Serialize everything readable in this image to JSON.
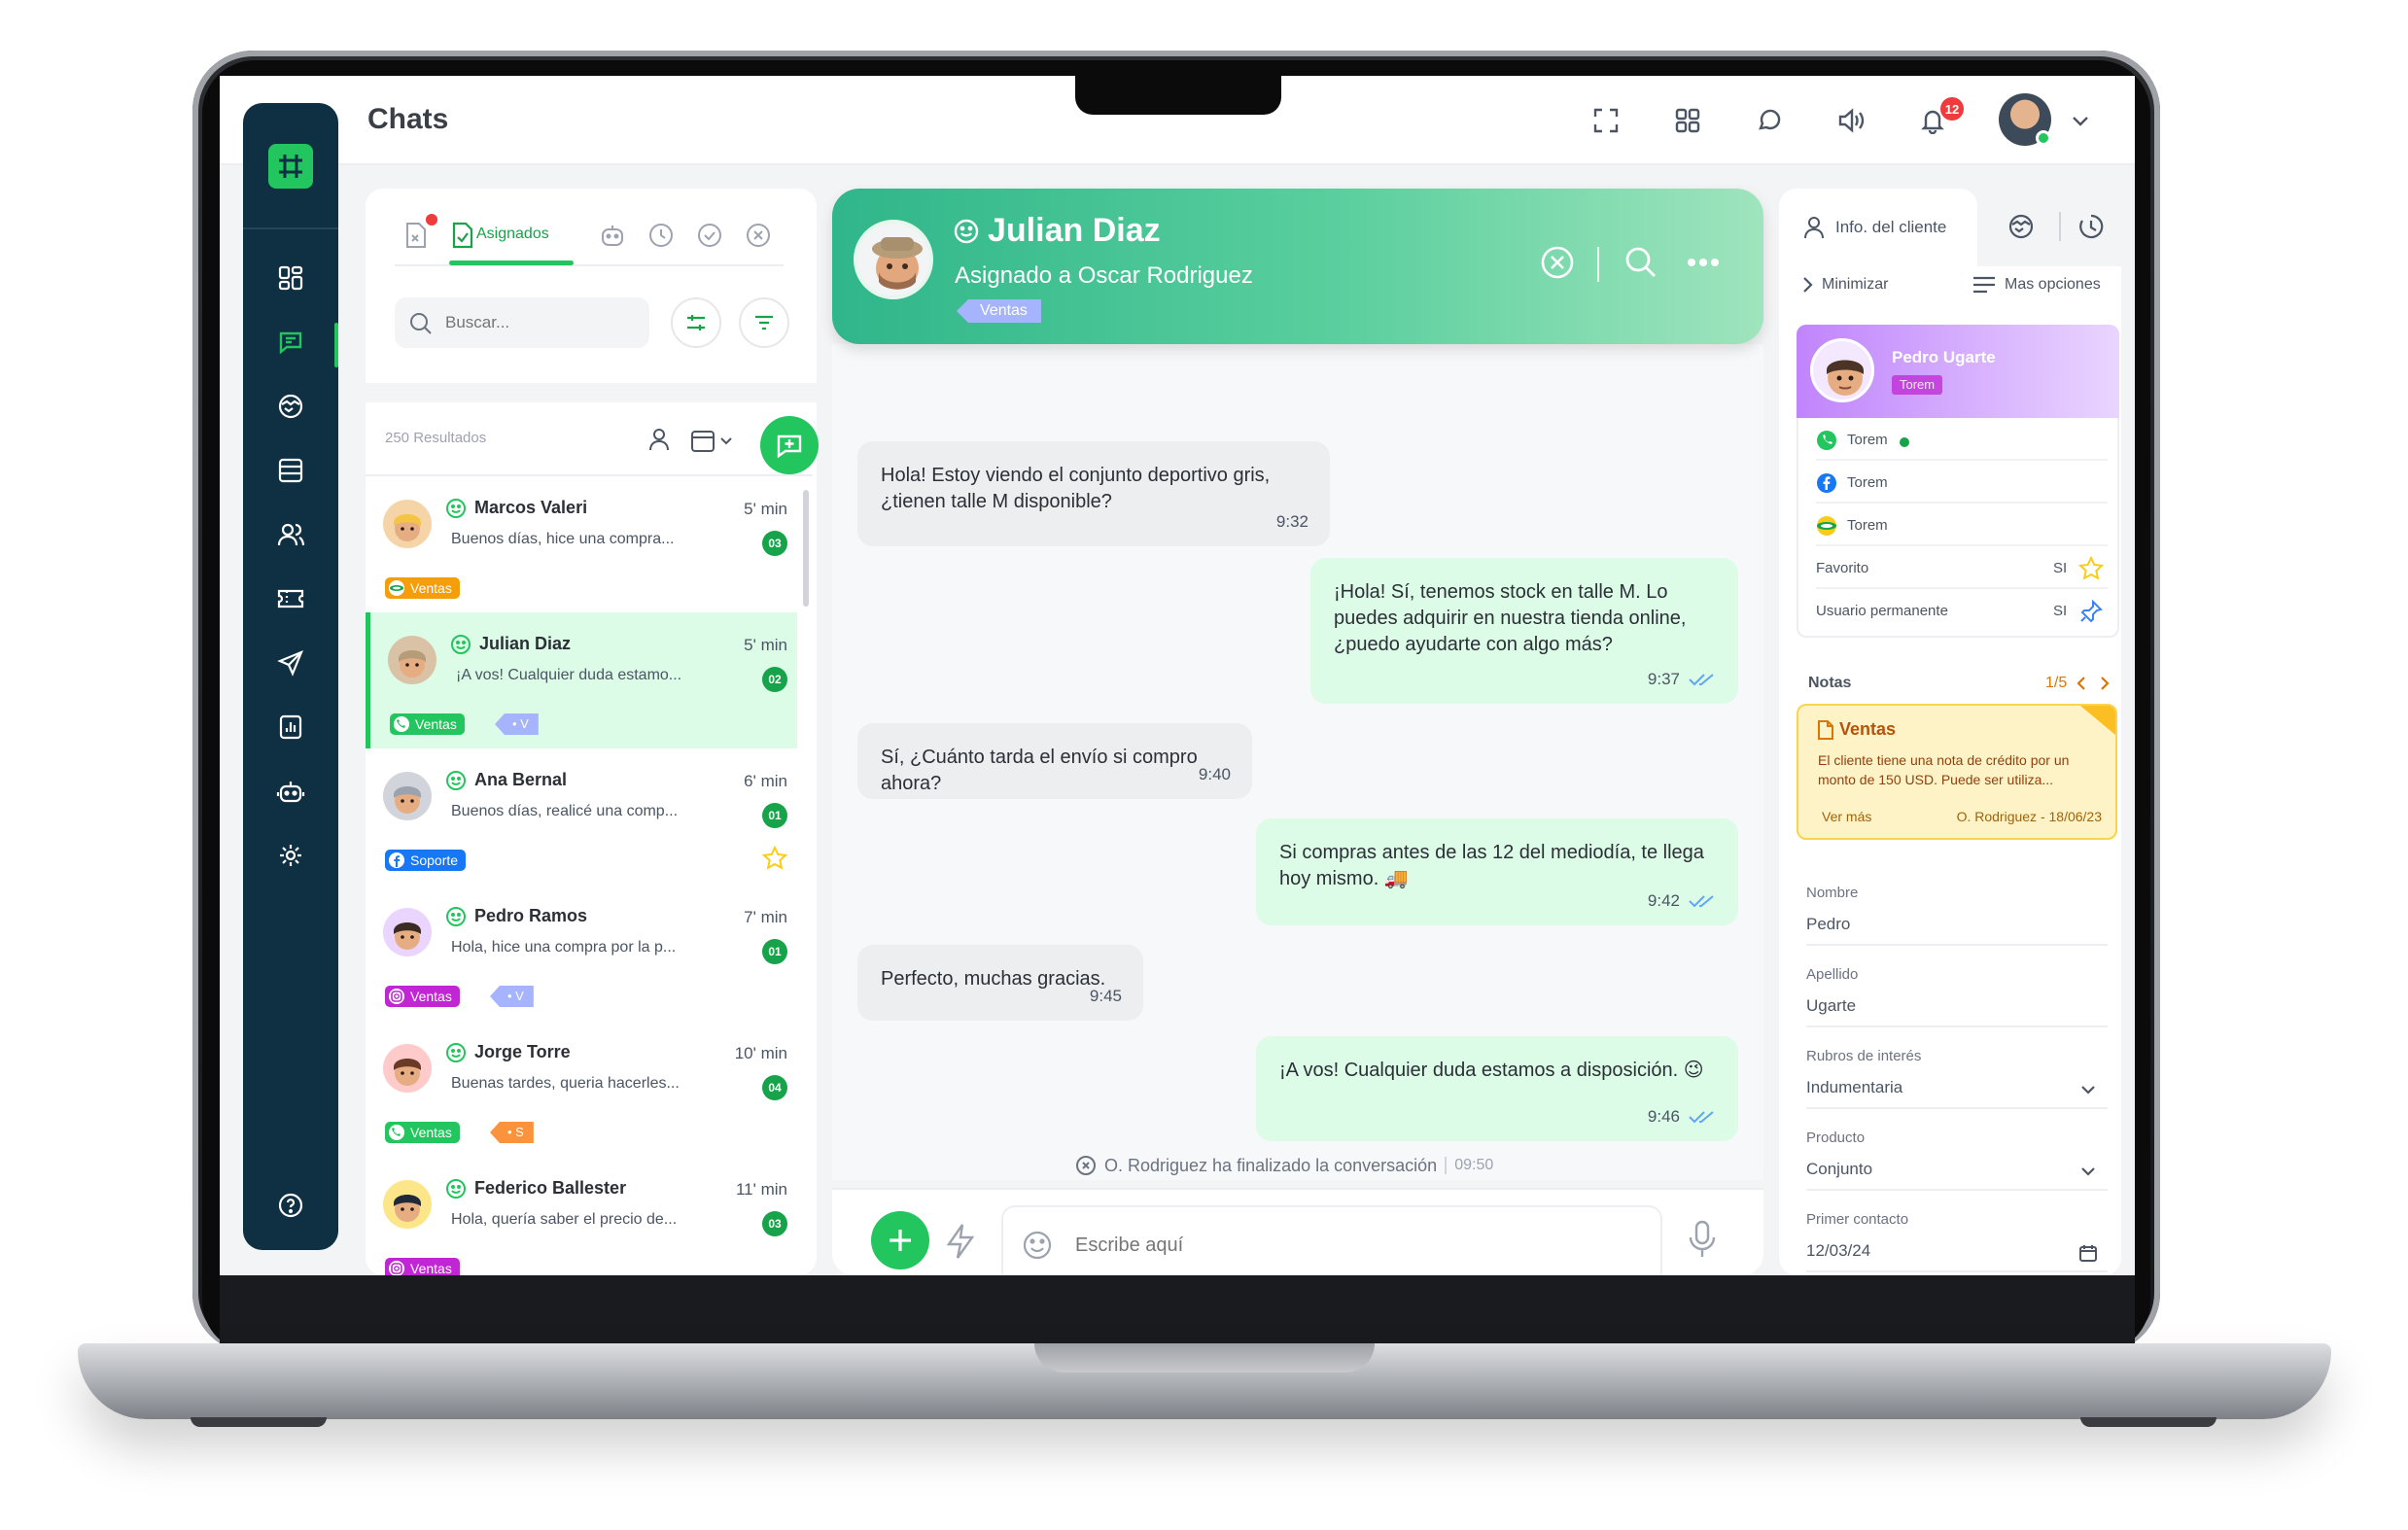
{
  "app": {
    "title": "Chats",
    "notifications_count": "12"
  },
  "list": {
    "active_tab_label": "Asignados",
    "search_placeholder": "Buscar...",
    "results": "250 Resultados",
    "chats": [
      {
        "name": "Marcos Valeri",
        "time": "5' min",
        "preview": "Buenos días, hice una compra...",
        "count": "03",
        "tag": "Ventas",
        "tag_color": "#f59e0b",
        "tag_icon": "coin-icon"
      },
      {
        "name": "Julian Diaz",
        "time": "5' min",
        "preview": "¡A vos! Cualquier duda estamo...",
        "count": "02",
        "tag": "Ventas",
        "tag_color": "#22c55e",
        "tag_icon": "whatsapp-icon",
        "tag2": "V",
        "tag2_color": "#a5b4fc"
      },
      {
        "name": "Ana Bernal",
        "time": "6' min",
        "preview": "Buenos días, realicé una comp...",
        "count": "01",
        "tag": "Soporte",
        "tag_color": "#1877f2",
        "tag_icon": "facebook-icon"
      },
      {
        "name": "Pedro Ramos",
        "time": "7' min",
        "preview": "Hola, hice una compra por la p...",
        "count": "01",
        "tag": "Ventas",
        "tag_color": "#c026d3",
        "tag_icon": "instagram-icon",
        "tag2": "V",
        "tag2_color": "#a5b4fc"
      },
      {
        "name": "Jorge Torre",
        "time": "10' min",
        "preview": "Buenas tardes, queria hacerles...",
        "count": "04",
        "tag": "Ventas",
        "tag_color": "#22c55e",
        "tag_icon": "whatsapp-icon",
        "tag2": "S",
        "tag2_color": "#fb923c"
      },
      {
        "name": "Federico Ballester",
        "time": "11' min",
        "preview": "Hola, quería saber el precio de...",
        "count": "03",
        "tag": "Ventas",
        "tag_color": "#c026d3",
        "tag_icon": "instagram-icon"
      }
    ]
  },
  "conversation": {
    "contact_name": "Julian Diaz",
    "assigned": "Asignado a Oscar Rodriguez",
    "tag": "Ventas",
    "messages": [
      {
        "dir": "in",
        "text": "Hola! Estoy viendo el conjunto deportivo gris, ¿tienen talle M disponible?",
        "time": "9:32"
      },
      {
        "dir": "out",
        "text": "¡Hola! Sí, tenemos stock en talle M. Lo puedes adquirir en nuestra tienda online, ¿puedo ayudarte con algo más?",
        "time": "9:37"
      },
      {
        "dir": "in",
        "text": "Sí, ¿Cuánto tarda el envío si compro ahora?",
        "time": "9:40"
      },
      {
        "dir": "out",
        "text": "Si compras antes de las 12 del mediodía, te llega hoy mismo. 🚚",
        "time": "9:42"
      },
      {
        "dir": "in",
        "text": "Perfecto, muchas gracias.",
        "time": "9:45"
      },
      {
        "dir": "out",
        "text": "¡A vos! Cualquier duda estamos a disposición. 😉",
        "time": "9:46"
      }
    ],
    "system_event": "O. Rodriguez ha finalizado la conversación",
    "system_time": "09:50",
    "input_placeholder": "Escribe aquí"
  },
  "client": {
    "tab_info": "Info. del cliente",
    "minimize": "Minimizar",
    "more_options": "Mas opciones",
    "name": "Pedro Ugarte",
    "tag": "Torem",
    "channels": [
      {
        "icon": "whatsapp-icon",
        "label": "Torem"
      },
      {
        "icon": "facebook-icon",
        "label": "Torem"
      },
      {
        "icon": "coin-icon",
        "label": "Torem"
      }
    ],
    "favorite_label": "Favorito",
    "favorite_value": "SI",
    "permanent_label": "Usuario permanente",
    "permanent_value": "SI",
    "notes_title": "Notas",
    "notes_page": "1/5",
    "note": {
      "title": "Ventas",
      "body": "El cliente tiene una nota de crédito por un monto de 150 USD. Puede ser utiliza...",
      "more": "Ver más",
      "author": "O. Rodriguez - 18/06/23"
    },
    "fields": [
      {
        "label": "Nombre",
        "value": "Pedro",
        "dropdown": false
      },
      {
        "label": "Apellido",
        "value": "Ugarte",
        "dropdown": false
      },
      {
        "label": "Rubros de interés",
        "value": "Indumentaria",
        "dropdown": true
      },
      {
        "label": "Producto",
        "value": "Conjunto",
        "dropdown": true
      },
      {
        "label": "Primer contacto",
        "value": "12/03/24",
        "dropdown": false
      }
    ]
  },
  "colors": {
    "brand": "#22c55e",
    "nav": "#0f2f43",
    "accent_badge": "#ef3b3b"
  }
}
